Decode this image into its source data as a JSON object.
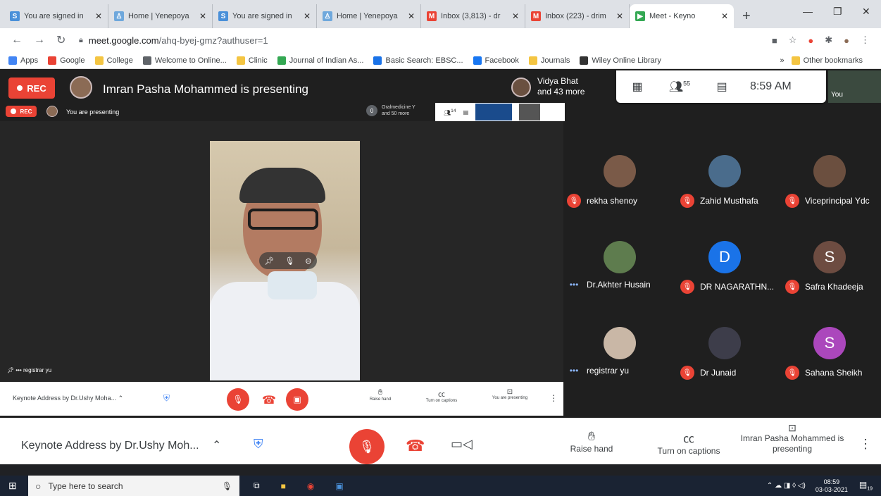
{
  "browser": {
    "tabs": [
      {
        "title": "You are signed in",
        "icon": "s-icon",
        "color": "#4a90d9",
        "letter": "S"
      },
      {
        "title": "Home | Yenepoya",
        "icon": "person-icon",
        "color": "#6fa8dc",
        "letter": "♙"
      },
      {
        "title": "You are signed in",
        "icon": "s-icon",
        "color": "#4a90d9",
        "letter": "S"
      },
      {
        "title": "Home | Yenepoya",
        "icon": "person-icon",
        "color": "#6fa8dc",
        "letter": "♙"
      },
      {
        "title": "Inbox (3,813) - dr",
        "icon": "gmail-icon",
        "color": "#ea4335",
        "letter": "M"
      },
      {
        "title": "Inbox (223) - drim",
        "icon": "gmail-icon",
        "color": "#ea4335",
        "letter": "M"
      },
      {
        "title": "Meet - Keyno",
        "icon": "meet-icon",
        "color": "#34a853",
        "letter": "▶"
      }
    ],
    "url_host": "meet.google.com",
    "url_path": "/ahq-byej-gmz?authuser=1",
    "bookmarks": [
      "Apps",
      "Google",
      "College",
      "Welcome to Online...",
      "Clinic",
      "Journal of Indian As...",
      "Basic Search: EBSC...",
      "Facebook",
      "Journals",
      "Wiley Online Library"
    ],
    "other_bookmarks": "Other bookmarks",
    "more": "»"
  },
  "meet": {
    "rec_label": "REC",
    "presenting_title": "Imran Pasha Mohammed is presenting",
    "inner_rec": "REC",
    "inner_presenting": "You are presenting",
    "inner_others_name": "Oralmedicine Y",
    "inner_others_more": "and 50 more",
    "inner_count": "14",
    "inner_others_badge": "0",
    "viewer_name": "Vidya Bhat",
    "viewer_more": "and 43 more",
    "people_count": "55",
    "time": "8:59 AM",
    "you_label": "You",
    "stage_name": "registrar yu",
    "inner_meeting_title": "Keynote Address by Dr.Ushy Moha...",
    "inner_raise": "Raise hand",
    "inner_captions": "Turn on captions",
    "inner_present": "You are presenting",
    "meeting_title": "Keynote Address by Dr.Ushy Moh...",
    "raise_hand": "Raise hand",
    "captions": "Turn on captions",
    "presenting_status": "Imran Pasha Mohammed is presenting"
  },
  "participants": [
    {
      "name": "rekha shenoy",
      "initial": "",
      "color": "#7a5a48",
      "muted": true
    },
    {
      "name": "Zahid Musthafa",
      "initial": "",
      "color": "#4a6c8c",
      "muted": true
    },
    {
      "name": "Viceprincipal Ydc",
      "initial": "",
      "color": "#6b4f3f",
      "muted": true
    },
    {
      "name": "Dr.Akhter Husain",
      "initial": "",
      "color": "#5e7c4e",
      "muted": false
    },
    {
      "name": "DR NAGARATHN...",
      "initial": "D",
      "color": "#1a73e8",
      "muted": true
    },
    {
      "name": "Safra Khadeeja",
      "initial": "S",
      "color": "#6d4c41",
      "muted": true
    },
    {
      "name": "registrar yu",
      "initial": "",
      "color": "#c9b7a6",
      "muted": false
    },
    {
      "name": "Dr Junaid",
      "initial": "",
      "color": "#3d3d4a",
      "muted": true
    },
    {
      "name": "Sahana Sheikh",
      "initial": "S",
      "color": "#ab47bc",
      "muted": true
    }
  ],
  "taskbar": {
    "search_placeholder": "Type here to search",
    "time": "08:59",
    "date": "03-03-2021",
    "notif": "19"
  }
}
